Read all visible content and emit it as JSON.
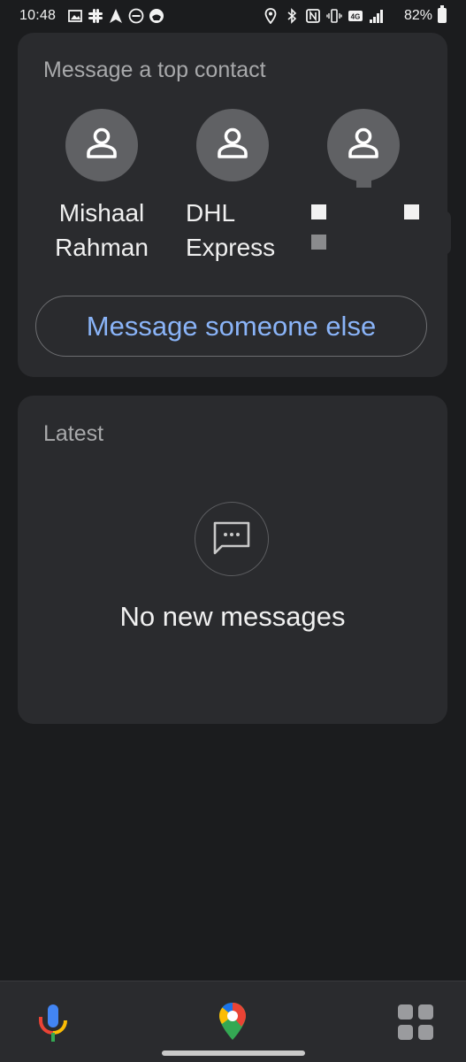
{
  "status_bar": {
    "time": "10:48",
    "battery": "82%",
    "left_icons": [
      "gallery-icon",
      "slack-icon",
      "navigation-arrow-icon",
      "do-not-disturb-icon",
      "android-auto-icon"
    ],
    "right_icons": [
      "location-icon",
      "bluetooth-icon",
      "nfc-icon",
      "vibrate-icon",
      "lte-icon",
      "signal-icon",
      "battery-icon"
    ]
  },
  "top_contacts": {
    "title": "Message a top contact",
    "contacts": [
      {
        "name": "Mishaal\nRahman"
      },
      {
        "name": "DHL\nExpress"
      },
      {
        "name": ""
      }
    ],
    "button_label": "Message someone else"
  },
  "latest": {
    "title": "Latest",
    "empty_icon": "message-dots-icon",
    "empty_text": "No new messages"
  },
  "bottom_nav": {
    "items": [
      "microphone-icon",
      "google-maps-icon",
      "app-grid-icon"
    ]
  },
  "colors": {
    "background": "#1b1c1e",
    "card": "#2a2b2e",
    "accent": "#8ab4f8",
    "muted_text": "#a8a9ab"
  }
}
